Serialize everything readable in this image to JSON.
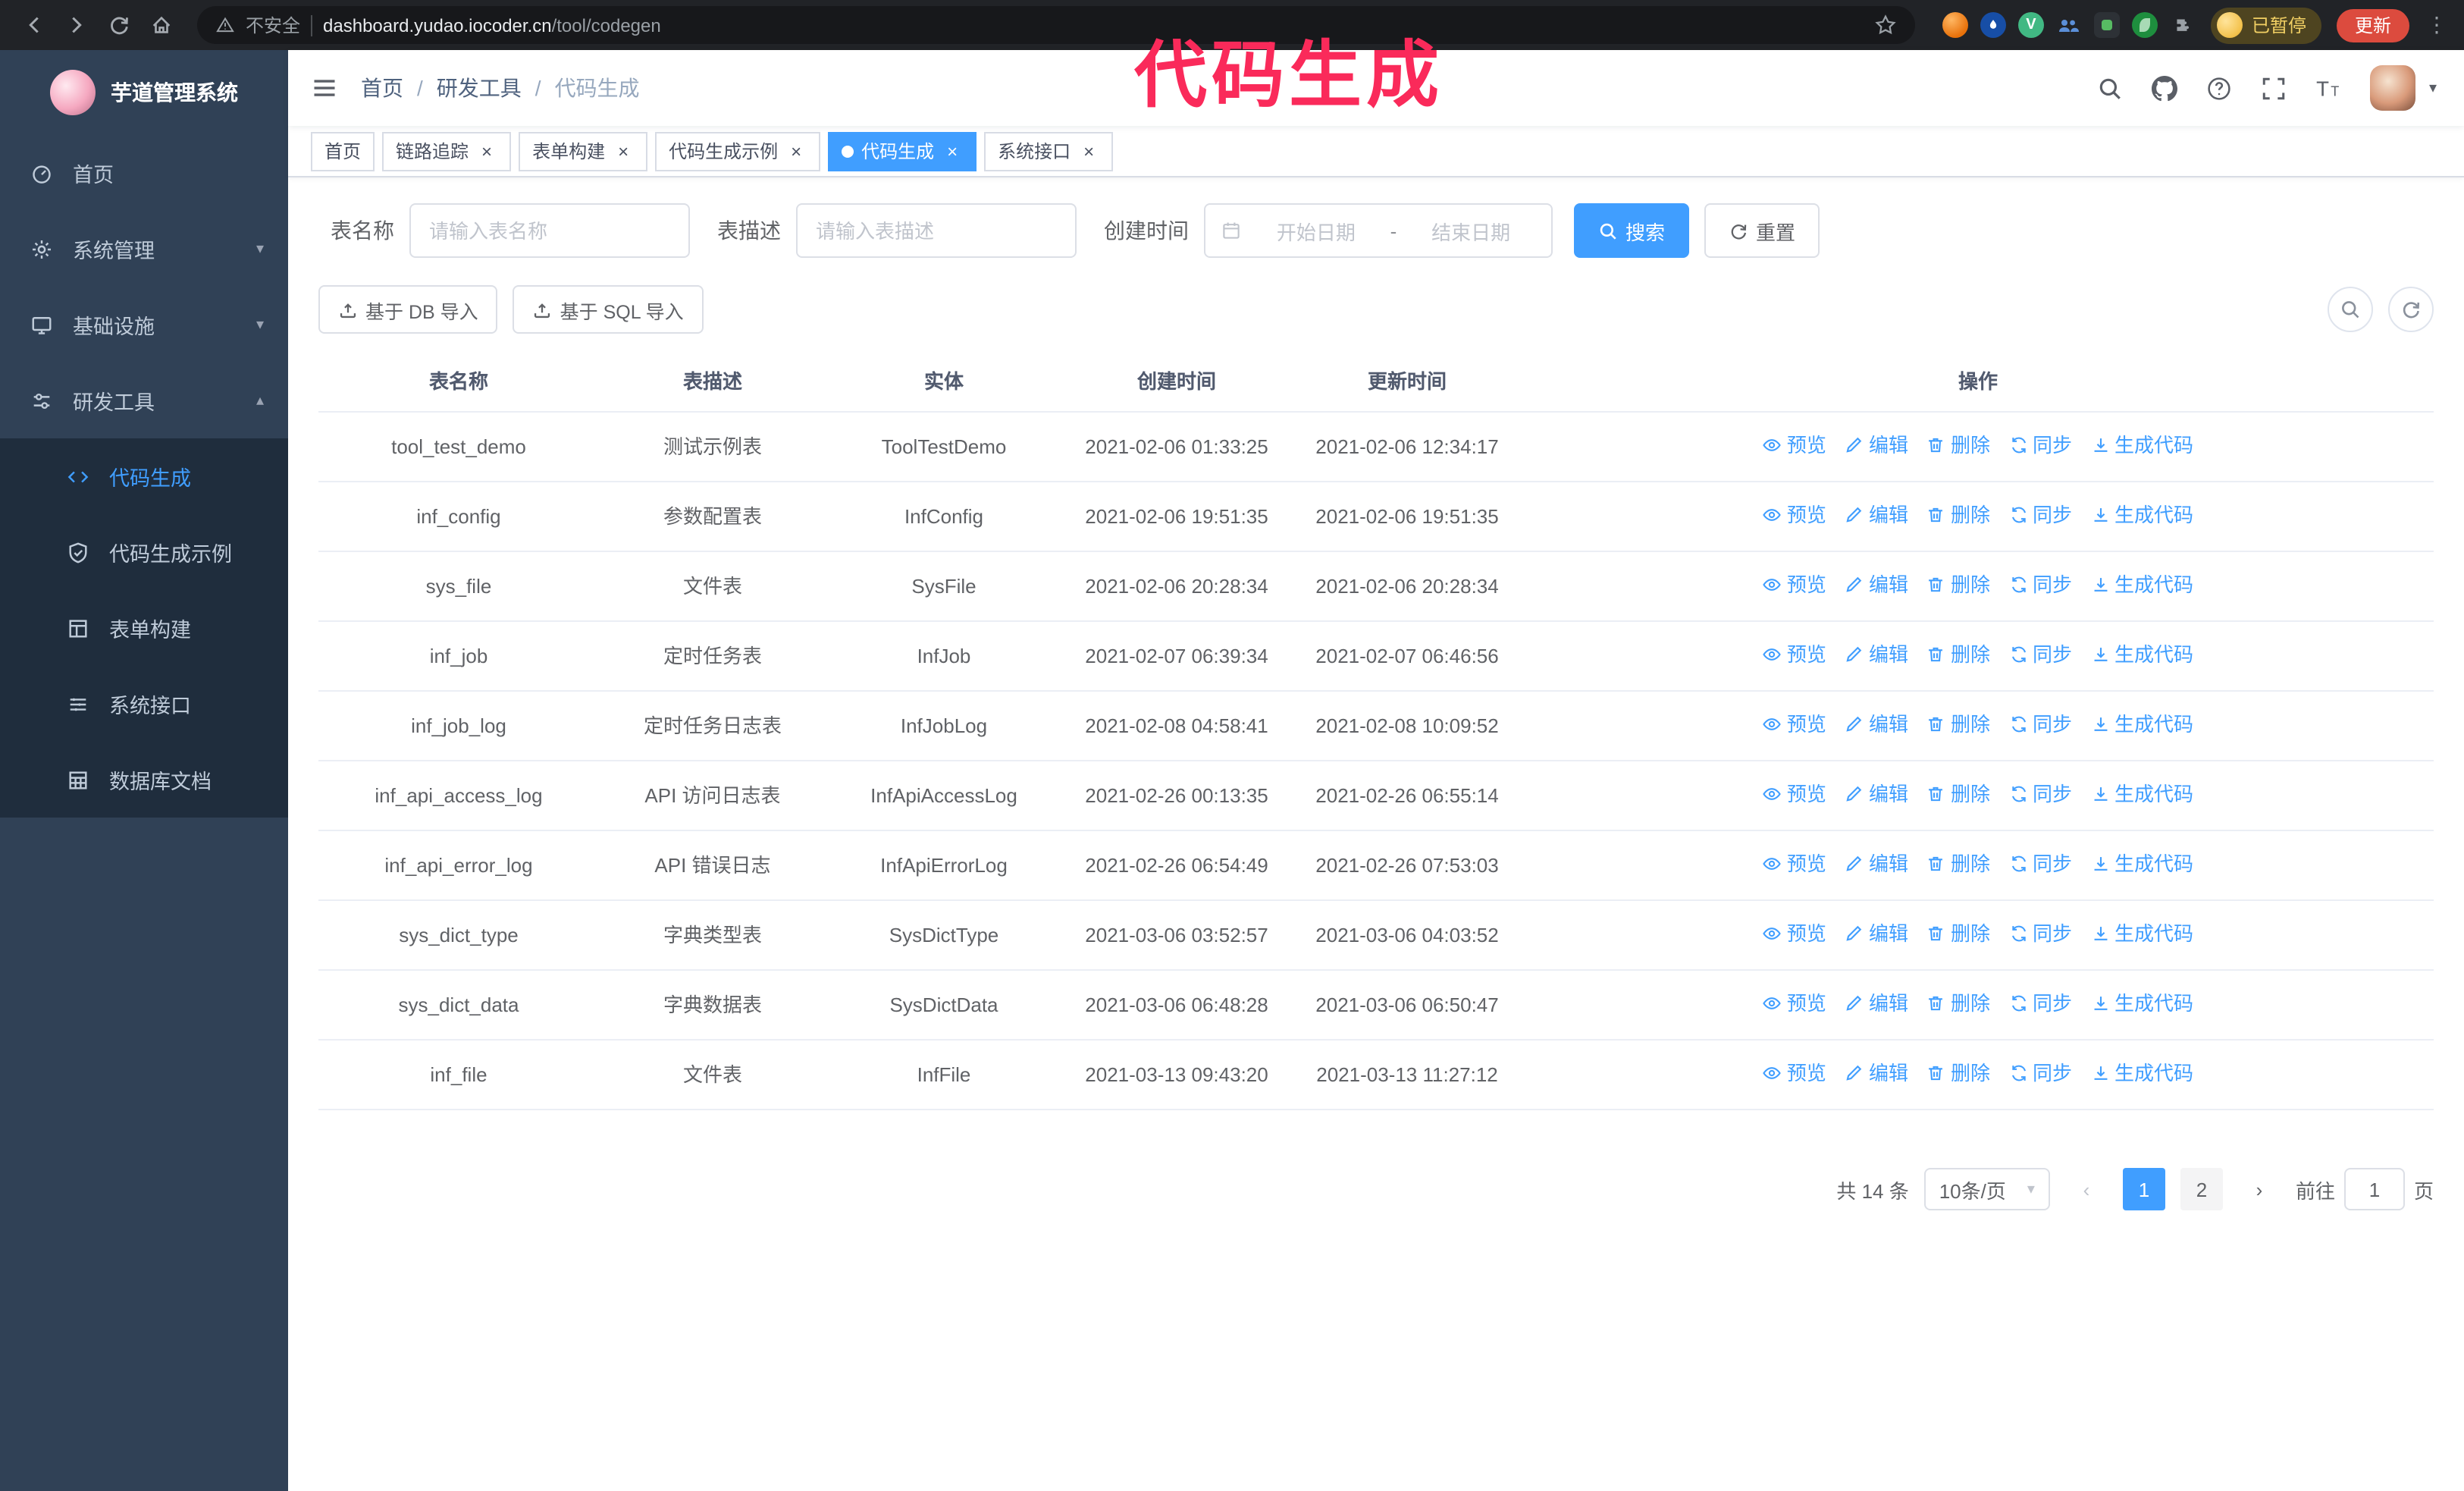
{
  "annotation": {
    "text": "代码生成"
  },
  "colors": {
    "accent": "#409eff",
    "sidebar_bg": "#304156",
    "submenu_bg": "#1f2d3d",
    "annotation": "#fa2a5a",
    "update_button_bg": "#dc4b3e",
    "active_tag_bg": "#409eff"
  },
  "icons": {
    "close": "×",
    "caret_down": "▾",
    "caret_up": "▴",
    "kebab": "⋮",
    "prev": "‹",
    "next": "›"
  },
  "browser": {
    "security_text": "不安全",
    "url_host": "dashboard.yudao.iocoder.cn",
    "url_path": "/tool/codegen",
    "profile_badge": "已暂停",
    "update_label": "更新"
  },
  "sidebar": {
    "title": "芋道管理系统",
    "items": [
      {
        "label": "首页"
      },
      {
        "label": "系统管理"
      },
      {
        "label": "基础设施"
      },
      {
        "label": "研发工具"
      }
    ],
    "subitems": [
      {
        "label": "代码生成",
        "active": true
      },
      {
        "label": "代码生成示例"
      },
      {
        "label": "表单构建"
      },
      {
        "label": "系统接口"
      },
      {
        "label": "数据库文档"
      }
    ]
  },
  "navbar": {
    "breadcrumb": {
      "home": "首页",
      "section": "研发工具",
      "current": "代码生成",
      "separator": "/"
    }
  },
  "tags": [
    {
      "label": "首页",
      "closable": false,
      "active": false
    },
    {
      "label": "链路追踪",
      "closable": true,
      "active": false
    },
    {
      "label": "表单构建",
      "closable": true,
      "active": false
    },
    {
      "label": "代码生成示例",
      "closable": true,
      "active": false
    },
    {
      "label": "代码生成",
      "closable": true,
      "active": true
    },
    {
      "label": "系统接口",
      "closable": true,
      "active": false
    }
  ],
  "filters": {
    "table_name_label": "表名称",
    "table_name_placeholder": "请输入表名称",
    "table_desc_label": "表描述",
    "table_desc_placeholder": "请输入表描述",
    "create_time_label": "创建时间",
    "date_start_placeholder": "开始日期",
    "date_separator": "-",
    "date_end_placeholder": "结束日期",
    "search_label": "搜索",
    "reset_label": "重置"
  },
  "toolbar": {
    "import_db_label": "基于 DB 导入",
    "import_sql_label": "基于 SQL 导入"
  },
  "table": {
    "headers": [
      "表名称",
      "表描述",
      "实体",
      "创建时间",
      "更新时间",
      "操作"
    ],
    "action_labels": [
      "预览",
      "编辑",
      "删除",
      "同步",
      "生成代码"
    ],
    "rows": [
      {
        "name": "tool_test_demo",
        "desc": "测试示例表",
        "entity": "ToolTestDemo",
        "created": "2021-02-06 01:33:25",
        "updated": "2021-02-06 12:34:17"
      },
      {
        "name": "inf_config",
        "desc": "参数配置表",
        "entity": "InfConfig",
        "created": "2021-02-06 19:51:35",
        "updated": "2021-02-06 19:51:35"
      },
      {
        "name": "sys_file",
        "desc": "文件表",
        "entity": "SysFile",
        "created": "2021-02-06 20:28:34",
        "updated": "2021-02-06 20:28:34"
      },
      {
        "name": "inf_job",
        "desc": "定时任务表",
        "entity": "InfJob",
        "created": "2021-02-07 06:39:34",
        "updated": "2021-02-07 06:46:56"
      },
      {
        "name": "inf_job_log",
        "desc": "定时任务日志表",
        "entity": "InfJobLog",
        "created": "2021-02-08 04:58:41",
        "updated": "2021-02-08 10:09:52"
      },
      {
        "name": "inf_api_access_log",
        "desc": "API 访问日志表",
        "entity": "InfApiAccessLog",
        "created": "2021-02-26 00:13:35",
        "updated": "2021-02-26 06:55:14"
      },
      {
        "name": "inf_api_error_log",
        "desc": "API 错误日志",
        "entity": "InfApiErrorLog",
        "created": "2021-02-26 06:54:49",
        "updated": "2021-02-26 07:53:03"
      },
      {
        "name": "sys_dict_type",
        "desc": "字典类型表",
        "entity": "SysDictType",
        "created": "2021-03-06 03:52:57",
        "updated": "2021-03-06 04:03:52"
      },
      {
        "name": "sys_dict_data",
        "desc": "字典数据表",
        "entity": "SysDictData",
        "created": "2021-03-06 06:48:28",
        "updated": "2021-03-06 06:50:47"
      },
      {
        "name": "inf_file",
        "desc": "文件表",
        "entity": "InfFile",
        "created": "2021-03-13 09:43:20",
        "updated": "2021-03-13 11:27:12"
      }
    ]
  },
  "pagination": {
    "total_text": "共 14 条",
    "page_size_text": "10条/页",
    "pages": [
      "1",
      "2"
    ],
    "active_page": "1",
    "goto_prefix": "前往",
    "goto_value": "1",
    "goto_suffix": "页"
  }
}
